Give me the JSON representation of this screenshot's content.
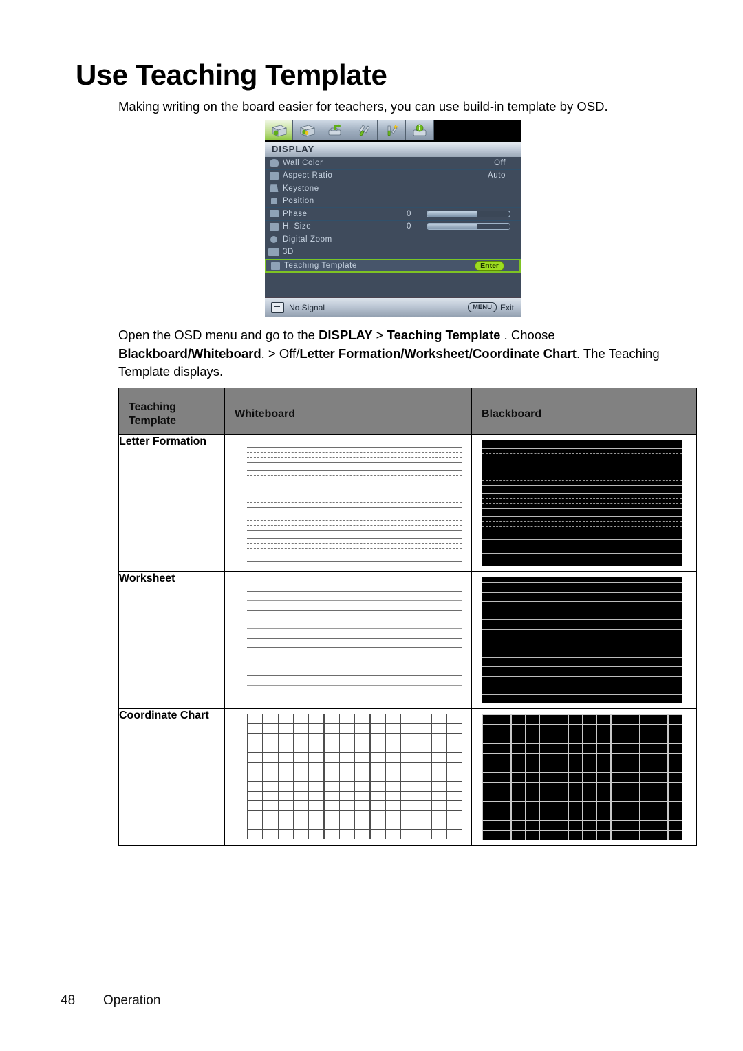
{
  "page": {
    "title": "Use Teaching Template",
    "intro": "Making writing on the board easier for teachers, you can use build-in template by OSD.",
    "footer_number": "48",
    "footer_section": "Operation"
  },
  "instructions": {
    "part1": "Open the OSD menu and go to the ",
    "bold1": "DISPLAY",
    "part2": " > ",
    "bold2": "Teaching Template",
    "part3": " . Choose ",
    "bold3": "Blackboard/Whiteboard",
    "part4": ". > Off/",
    "bold4": "Letter Formation/Worksheet/Coordinate Chart",
    "part5": ". The Teaching Template displays."
  },
  "osd": {
    "menu_title": "DISPLAY",
    "tabs": [
      {
        "name": "display-tab",
        "icon": "display-icon",
        "active": true
      },
      {
        "name": "picture-tab",
        "icon": "picture-icon",
        "active": false
      },
      {
        "name": "source-tab",
        "icon": "source-icon",
        "active": false
      },
      {
        "name": "system-setup-basic-tab",
        "icon": "tools-icon",
        "active": false
      },
      {
        "name": "system-setup-advanced-tab",
        "icon": "tools-plus-icon",
        "active": false
      },
      {
        "name": "information-tab",
        "icon": "info-icon",
        "active": false
      }
    ],
    "rows": [
      {
        "label": "Wall Color",
        "value": "Off",
        "type": "value"
      },
      {
        "label": "Aspect Ratio",
        "value": "Auto",
        "type": "value"
      },
      {
        "label": "Keystone",
        "value": "",
        "type": "plain"
      },
      {
        "label": "Position",
        "value": "",
        "type": "plain"
      },
      {
        "label": "Phase",
        "value": "0",
        "type": "slider"
      },
      {
        "label": "H. Size",
        "value": "0",
        "type": "slider"
      },
      {
        "label": "Digital Zoom",
        "value": "",
        "type": "plain"
      },
      {
        "label": "3D",
        "value": "",
        "type": "plain"
      },
      {
        "label": "Teaching Template",
        "value": "Enter",
        "type": "enter",
        "selected": true
      }
    ],
    "status_text": "No Signal",
    "exit_key": "MENU",
    "exit_label": "Exit",
    "highlight_color": "#7ec324",
    "enter_badge_color": "#9ddd20"
  },
  "table": {
    "headers": [
      "Teaching Template",
      "Whiteboard",
      "Blackboard"
    ],
    "rows": [
      {
        "label": "Letter Formation",
        "whiteboard": "letter-formation-light",
        "blackboard": "letter-formation-dark"
      },
      {
        "label": "Worksheet",
        "whiteboard": "worksheet-light",
        "blackboard": "worksheet-dark"
      },
      {
        "label": "Coordinate Chart",
        "whiteboard": "coordinate-chart-light",
        "blackboard": "coordinate-chart-dark"
      }
    ]
  }
}
